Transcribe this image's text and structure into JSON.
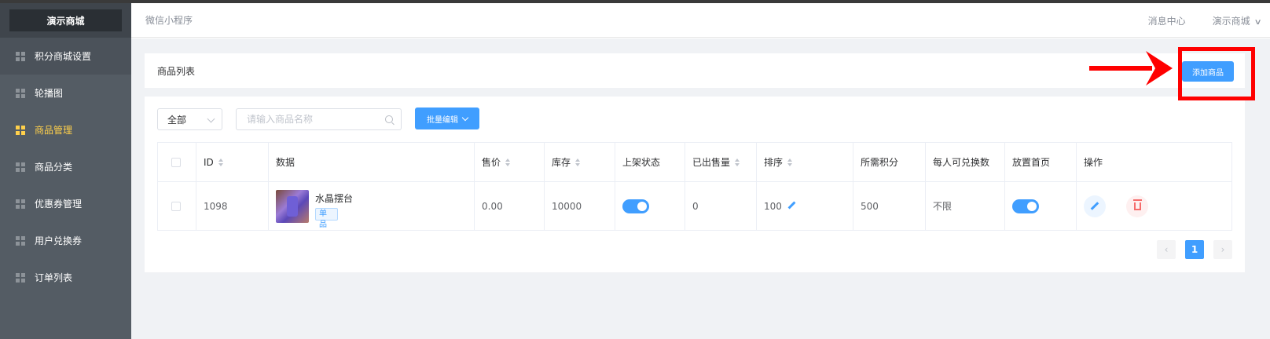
{
  "sidebar": {
    "brand": "演示商城",
    "items": [
      {
        "label": "积分商城设置",
        "icon": "grid-icon"
      },
      {
        "label": "轮播图",
        "icon": "grid-icon"
      },
      {
        "label": "商品管理",
        "icon": "grid-icon",
        "active": true
      },
      {
        "label": "商品分类",
        "icon": "grid-icon"
      },
      {
        "label": "优惠券管理",
        "icon": "grid-icon"
      },
      {
        "label": "用户兑换券",
        "icon": "grid-icon"
      },
      {
        "label": "订单列表",
        "icon": "grid-icon"
      }
    ]
  },
  "header": {
    "title": "微信小程序",
    "message_center": "消息中心",
    "user_menu": "演示商城",
    "user_menu_chevron": "∨"
  },
  "product_list": {
    "title": "商品列表",
    "add_button": "添加商品"
  },
  "filters": {
    "status_select": "全部",
    "search_placeholder": "请输入商品名称",
    "batch_edit": "批量编辑"
  },
  "table": {
    "columns": [
      "ID",
      "数据",
      "售价",
      "库存",
      "上架状态",
      "已出售量",
      "排序",
      "所需积分",
      "每人可兑换数",
      "放置首页",
      "操作"
    ],
    "rows": [
      {
        "id": "1098",
        "name": "水晶摆台",
        "tag": "单品",
        "price": "0.00",
        "stock": "10000",
        "listed": true,
        "sold": "0",
        "sort": "100",
        "points": "500",
        "limit": "不限",
        "homepage": true
      }
    ]
  },
  "pagination": {
    "prev": "‹",
    "current": "1",
    "next": "›"
  },
  "colors": {
    "sidebar_bg": "#545c64",
    "active": "#ffd04b",
    "primary": "#409eff",
    "danger": "#f56c6c",
    "annotation": "#ff0000"
  }
}
